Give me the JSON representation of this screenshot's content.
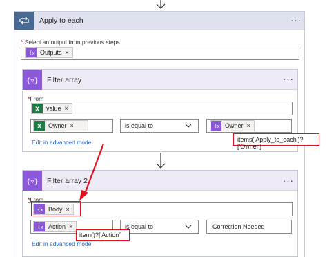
{
  "apply_to_each": {
    "title": "Apply to each",
    "menu": "···",
    "select_label_req": "*",
    "select_label": "Select an output from previous steps",
    "token": {
      "label": "Outputs",
      "remove": "×"
    }
  },
  "filter_array_1": {
    "title": "Filter array",
    "menu": "···",
    "from_req": "*",
    "from_label": "From",
    "from_token": {
      "label": "value",
      "remove": "×"
    },
    "left_token": {
      "label": "Owner",
      "remove": "×"
    },
    "operator": "is equal to",
    "right_token": {
      "label": "Owner",
      "remove": "×"
    },
    "advanced_link": "Edit in advanced mode",
    "annotation": "items('Apply_to_each')?['Owner']"
  },
  "filter_array_2": {
    "title": "Filter array 2",
    "menu": "···",
    "from_req": "*",
    "from_label": "From",
    "from_token": {
      "label": "Body",
      "remove": "×"
    },
    "left_token": {
      "label": "Action",
      "remove": "×"
    },
    "operator": "is equal to",
    "right_value": "Correction Needed",
    "advanced_link": "Edit in advanced mode",
    "annotation": "item()?['Action']"
  },
  "colors": {
    "apply_header": "#dfe2ee",
    "apply_icon": "#486991",
    "filter_header": "#eeebf7",
    "filter_icon": "#8a58d9",
    "excel_green": "#1f7b45",
    "annotation_red": "#e0101f",
    "link_blue": "#1e63c7"
  },
  "icons": [
    "loop-icon",
    "filter-icon",
    "excel-icon",
    "expression-icon",
    "chevron-down-icon",
    "arrow-down-icon",
    "red-arrow-annotation"
  ]
}
